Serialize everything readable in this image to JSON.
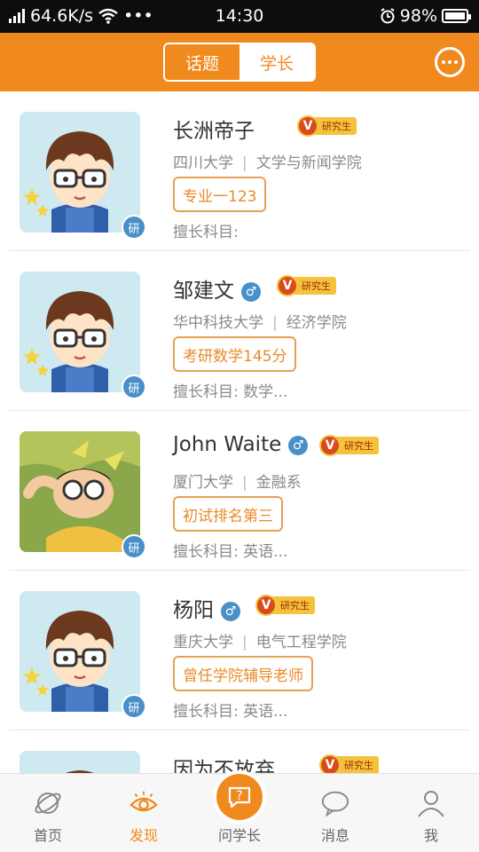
{
  "status_bar": {
    "speed": "64.6K/s",
    "more": "•••",
    "time": "14:30",
    "battery_percent": "98%",
    "battery_level": 0.98
  },
  "header": {
    "tabs": [
      {
        "label": "话题"
      },
      {
        "label": "学长"
      }
    ],
    "active_tab": "学长",
    "chat_icon": "chat-bubble-icon"
  },
  "seniors": [
    {
      "name": "长洲帝子",
      "gender": "",
      "vip_label": "研究生",
      "vip_mark": "V",
      "school": "四川大学",
      "department": "文学与新闻学院",
      "tag": "专业一123",
      "skill": "擅长科目:",
      "avatar_badge": "研",
      "avatar": "cartoon-boy"
    },
    {
      "name": "邹建文",
      "gender": "♂",
      "vip_label": "研究生",
      "vip_mark": "V",
      "school": "华中科技大学",
      "department": "经济学院",
      "tag": "考研数学145分",
      "skill": "擅长科目:  数学...",
      "avatar_badge": "研",
      "avatar": "cartoon-boy"
    },
    {
      "name": "John Waite",
      "gender": "♂",
      "vip_label": "研究生",
      "vip_mark": "V",
      "school": "厦门大学",
      "department": "金融系",
      "tag": "初试排名第三",
      "skill": "擅长科目:  英语...",
      "avatar_badge": "研",
      "avatar": "photo"
    },
    {
      "name": "杨阳",
      "gender": "♂",
      "vip_label": "研究生",
      "vip_mark": "V",
      "school": "重庆大学",
      "department": "电气工程学院",
      "tag": "曾任学院辅导老师",
      "skill": "擅长科目:  英语...",
      "avatar_badge": "研",
      "avatar": "cartoon-boy"
    },
    {
      "name": "因为不放弃",
      "gender": "",
      "vip_label": "研究生",
      "vip_mark": "V",
      "school": "",
      "department": "",
      "tag": "",
      "skill": "",
      "avatar_badge": "",
      "avatar": "cartoon-boy"
    }
  ],
  "bottom_nav": [
    {
      "label": "首页",
      "icon": "planet-icon",
      "active": false
    },
    {
      "label": "发现",
      "icon": "eye-icon",
      "active": true
    },
    {
      "label": "问学长",
      "icon": "question-bubble-icon",
      "active": false
    },
    {
      "label": "消息",
      "icon": "message-bubble-icon",
      "active": false
    },
    {
      "label": "我",
      "icon": "person-icon",
      "active": false
    }
  ],
  "colors": {
    "brand": "#f08a1e",
    "gender_badge": "#4a90c8",
    "vip_gold": "#f5c33b",
    "vip_red": "#d94a1c"
  }
}
